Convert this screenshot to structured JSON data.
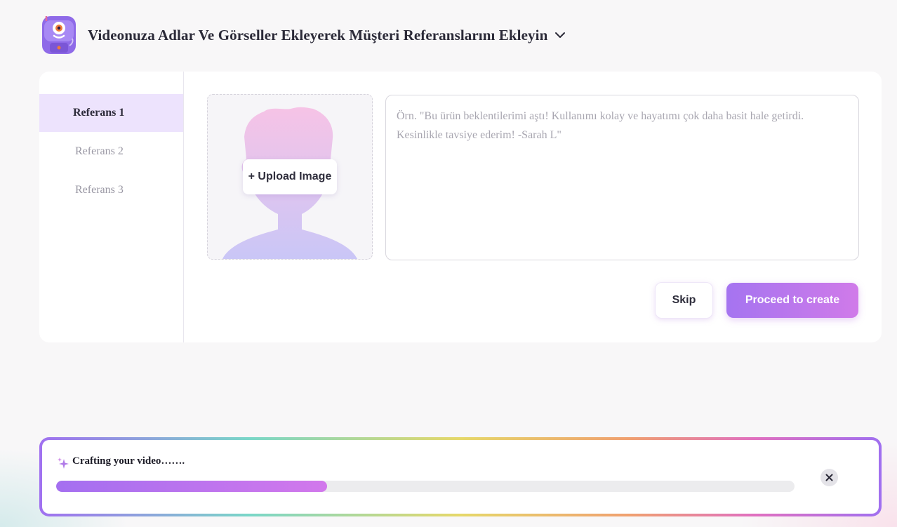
{
  "header": {
    "title": "Videonuza Adlar Ve Görseller Ekleyerek Müşteri Referanslarını Ekleyin",
    "logo_icon": "robot-mascot-icon",
    "dropdown_icon": "chevron-down-icon"
  },
  "sidebar": {
    "items": [
      {
        "label": "Referans 1",
        "active": true
      },
      {
        "label": "Referans 2",
        "active": false
      },
      {
        "label": "Referans 3",
        "active": false
      }
    ]
  },
  "upload": {
    "button_label": "+ Upload Image",
    "placeholder_icon": "person-silhouette-icon"
  },
  "testimonial": {
    "value": "",
    "placeholder": "Örn. \"Bu ürün beklentilerimi aştı! Kullanımı kolay ve hayatımı çok daha basit hale getirdi. Kesinlikle tavsiye ederim! -Sarah L\""
  },
  "actions": {
    "skip_label": "Skip",
    "proceed_label": "Proceed to create"
  },
  "progress": {
    "status_text": "Crafting your video…….",
    "percent": 36.7,
    "icon": "sparkle-icon",
    "close_icon": "close-icon"
  },
  "colors": {
    "accent_start": "#a574f0",
    "accent_end": "#d07ae9",
    "active_tab_bg": "#ede3fd"
  }
}
